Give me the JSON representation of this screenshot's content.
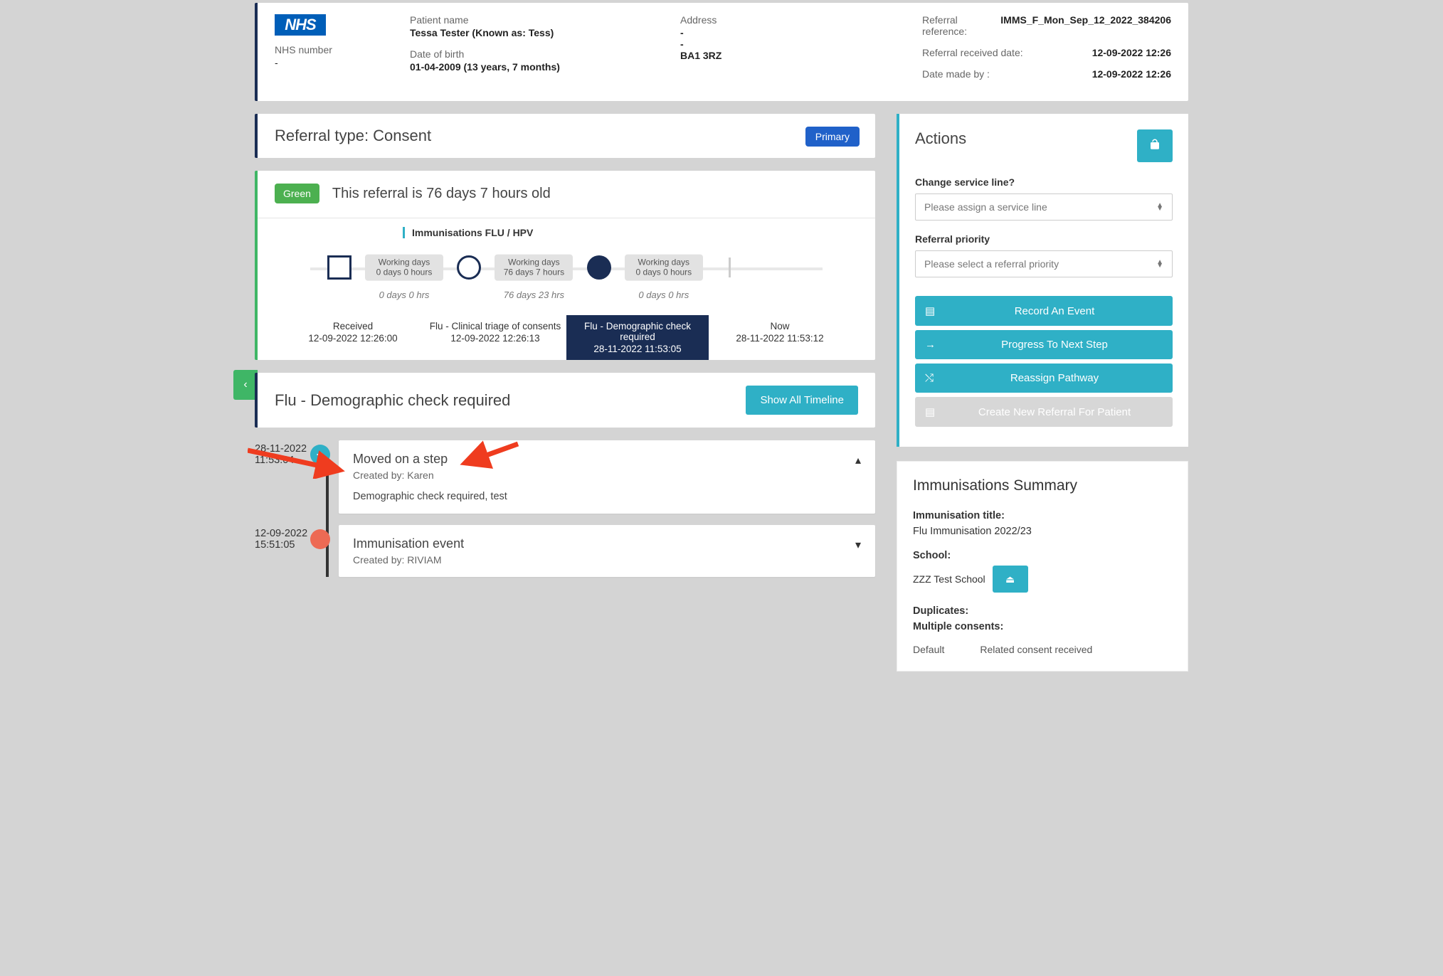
{
  "header": {
    "nhs_logo": "NHS",
    "nhs_number_label": "NHS number",
    "nhs_number_value": "-",
    "patient_name_label": "Patient name",
    "patient_name_value": "Tessa Tester (Known as: Tess)",
    "dob_label": "Date of birth",
    "dob_value": "01-04-2009 (13 years, 7 months)",
    "address_label": "Address",
    "address_line1": "-",
    "address_line2": "-",
    "address_line3": "BA1 3RZ",
    "ref_ref_label": "Referral reference:",
    "ref_ref_value": "IMMS_F_Mon_Sep_12_2022_384206",
    "ref_recv_label": "Referral received date:",
    "ref_recv_value": "12-09-2022 12:26",
    "made_by_label": "Date made by :",
    "made_by_value": "12-09-2022 12:26"
  },
  "referral_type": {
    "title": "Referral type: Consent",
    "badge": "Primary"
  },
  "status": {
    "badge": "Green",
    "age_text": "This referral is 76 days 7 hours old",
    "pathway": "Immunisations FLU / HPV",
    "badges": [
      {
        "l1": "Working days",
        "l2": "0 days 0 hours"
      },
      {
        "l1": "Working days",
        "l2": "76 days 7 hours"
      },
      {
        "l1": "Working days",
        "l2": "0 days 0 hours"
      }
    ],
    "under": [
      "0 days 0 hrs",
      "76 days 23 hrs",
      "0 days 0 hrs"
    ],
    "stages": [
      {
        "title": "Received",
        "time": "12-09-2022 12:26:00"
      },
      {
        "title": "Flu - Clinical triage of consents",
        "time": "12-09-2022 12:26:13"
      },
      {
        "title": "Flu - Demographic check required",
        "time": "28-11-2022 11:53:05"
      },
      {
        "title": "Now",
        "time": "28-11-2022 11:53:12"
      }
    ]
  },
  "timeline": {
    "heading": "Flu - Demographic check required",
    "show_all_btn": "Show All Timeline",
    "events": [
      {
        "date": "28-11-2022",
        "time": "11:53:04",
        "title": "Moved on a step",
        "created": "Created by: Karen",
        "body": "Demographic check required, test",
        "expanded": true
      },
      {
        "date": "12-09-2022",
        "time": "15:51:05",
        "title": "Immunisation event",
        "created": "Created by: RIVIAM",
        "body": "",
        "expanded": false
      }
    ]
  },
  "actions": {
    "title": "Actions",
    "change_line_label": "Change service line?",
    "change_line_placeholder": "Please assign a service line",
    "priority_label": "Referral priority",
    "priority_placeholder": "Please select a referral priority",
    "buttons": [
      {
        "icon": "▤",
        "label": "Record An Event"
      },
      {
        "icon": "→",
        "label": "Progress To Next Step"
      },
      {
        "icon": "⤭",
        "label": "Reassign Pathway"
      },
      {
        "icon": "▤",
        "label": "Create New Referral For Patient"
      }
    ]
  },
  "summary": {
    "title": "Immunisations Summary",
    "imm_title_label": "Immunisation title:",
    "imm_title_value": "Flu Immunisation 2022/23",
    "school_label": "School:",
    "school_value": "ZZZ Test School",
    "dup_label": "Duplicates:",
    "mult_label": "Multiple consents:",
    "col1": "Default",
    "col2": "Related consent received"
  }
}
